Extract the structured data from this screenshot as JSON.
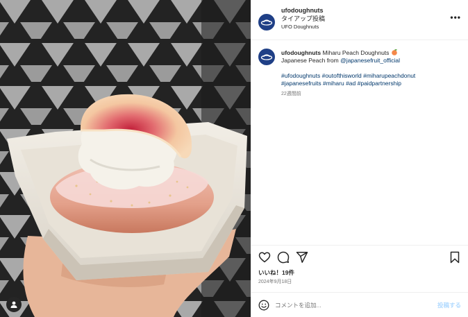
{
  "post": {
    "username": "ufodoughnuts",
    "subtitle": "タイアップ投稿",
    "location": "UFO Doughnuts",
    "more_label": "•••"
  },
  "caption": {
    "username": "ufodoughnuts",
    "title": "Miharu Peach Doughnuts",
    "line2_prefix": "Japanese Peach from ",
    "mention": "@japanesefruit_official",
    "hashtags_line1": "#ufodoughnuts #outofthisworld #miharupeachdonut",
    "hashtags_line2": "#japanesefruits #miharu #ad #paidpartnership",
    "time_ago": "22週間前"
  },
  "actions": {
    "icons": [
      "heart-icon",
      "comment-icon",
      "share-icon",
      "bookmark-icon"
    ]
  },
  "likes": "いいね！19件",
  "date": "2024年9月18日",
  "comment": {
    "placeholder": "コメントを追加...",
    "post_label": "投稿する"
  },
  "colors": {
    "avatar": "#1f3f86",
    "link": "#00376b",
    "post_button_disabled": "#b3dbff"
  }
}
